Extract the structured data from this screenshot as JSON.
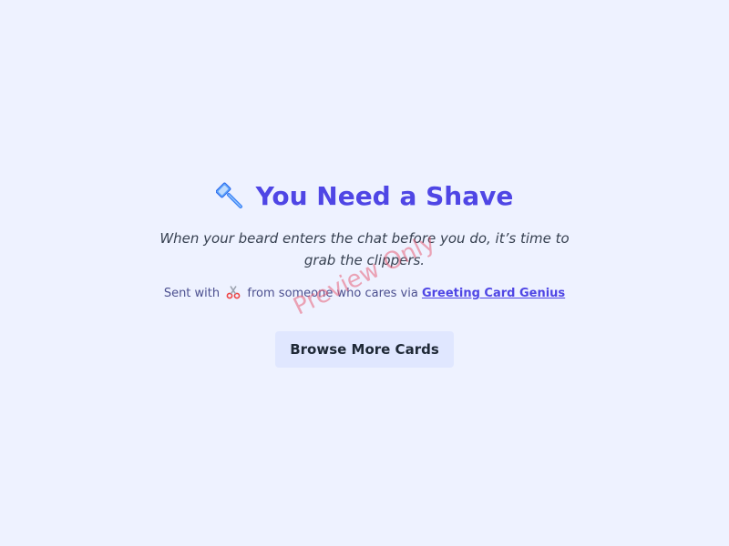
{
  "card": {
    "icon": "razor-icon",
    "title": "You Need a Shave",
    "message": "When your beard enters the chat before you do, it’s time to grab the clippers.",
    "sent_prefix": "Sent with",
    "sent_icon": "scissors-icon",
    "sent_middle": "from someone who cares via",
    "brand_link": "Greeting Card Genius",
    "button_label": "Browse More Cards"
  },
  "watermark": "Preview Only",
  "colors": {
    "background": "#eef2ff",
    "title": "#4f46e5",
    "button_bg": "#e0e7ff",
    "watermark": "#e86178"
  }
}
